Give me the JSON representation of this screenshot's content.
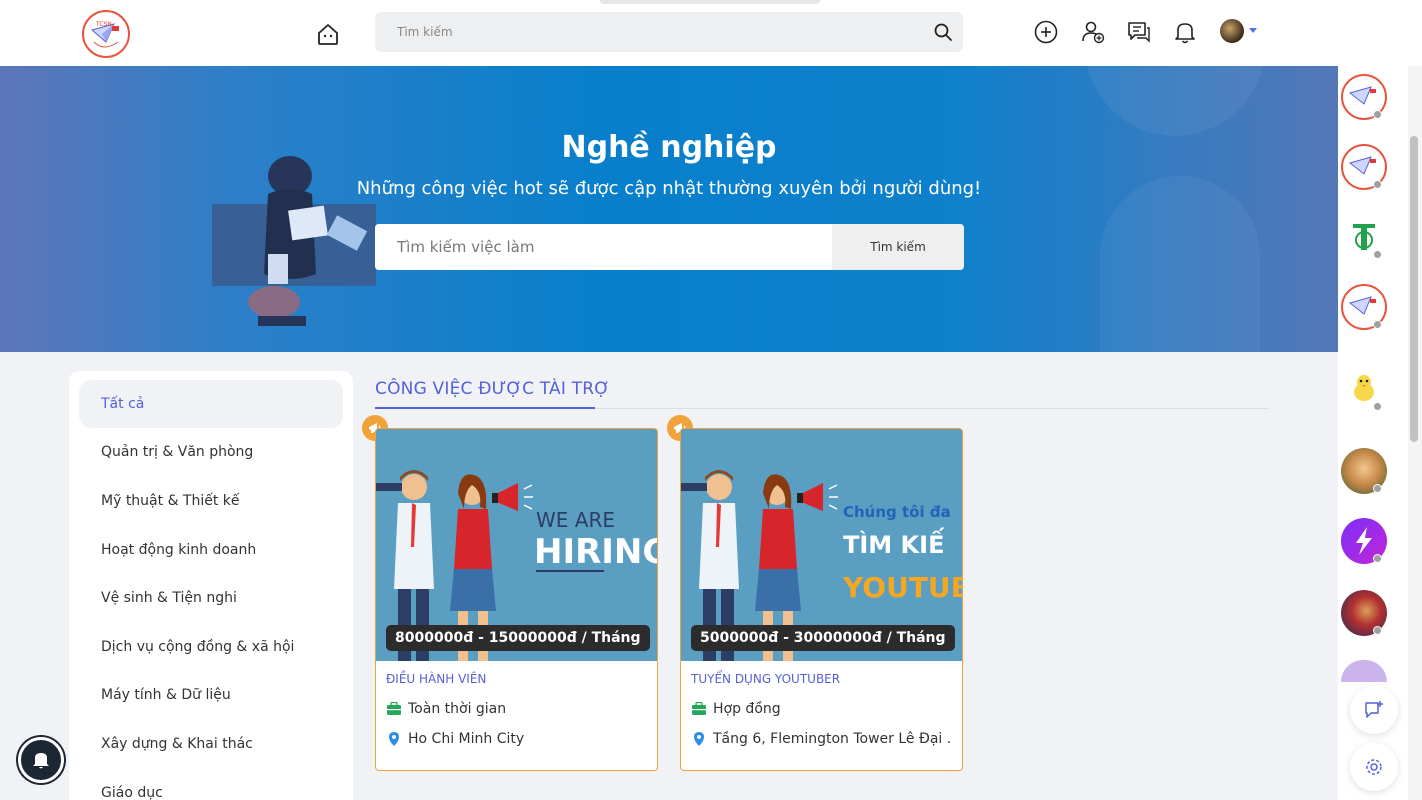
{
  "app": {
    "logo_text": "TCSN"
  },
  "nav": {
    "search_placeholder": "Tìm kiếm",
    "icons": [
      "home-icon",
      "add-circle-icon",
      "add-friend-icon",
      "chat-icon",
      "bell-icon",
      "user-avatar"
    ]
  },
  "hero": {
    "title": "Nghề nghiệp",
    "subtitle": "Những công việc hot sẽ được cập nhật thường xuyên bởi người dùng!",
    "search_placeholder": "Tìm kiếm việc làm",
    "search_button": "Tìm kiếm"
  },
  "categories": [
    {
      "label": "Tất cả",
      "active": true
    },
    {
      "label": "Quản trị & Văn phòng"
    },
    {
      "label": "Mỹ thuật & Thiết kế"
    },
    {
      "label": "Hoạt động kinh doanh"
    },
    {
      "label": "Vệ sinh & Tiện nghi"
    },
    {
      "label": "Dịch vụ cộng đồng & xã hội"
    },
    {
      "label": "Máy tính & Dữ liệu"
    },
    {
      "label": "Xây dựng & Khai thác"
    },
    {
      "label": "Giáo dục"
    }
  ],
  "section": {
    "title": "CÔNG VIỆC ĐƯỢC TÀI TRỢ"
  },
  "jobs": [
    {
      "title": "ĐIỀU HÀNH VIÊN",
      "salary": "8000000đ - 15000000đ / Tháng",
      "type": "Toàn thời gian",
      "location": "Ho Chi Minh City",
      "banner_line1": "WE ARE",
      "banner_line2": "HIRING"
    },
    {
      "title": "TUYỂN DỤNG YOUTUBER",
      "salary": "5000000đ - 30000000đ / Tháng",
      "type": "Hợp đồng",
      "location": "Tầng 6, Flemington Tower Lê Đại ...",
      "banner_line1": "Chúng tôi đa",
      "banner_line2": "TÌM KIẾ",
      "banner_line3": "YOUTUBE"
    }
  ],
  "colors": {
    "accent": "#5561d6",
    "sponsor": "#f1a33a",
    "hero": "#087fcc"
  }
}
